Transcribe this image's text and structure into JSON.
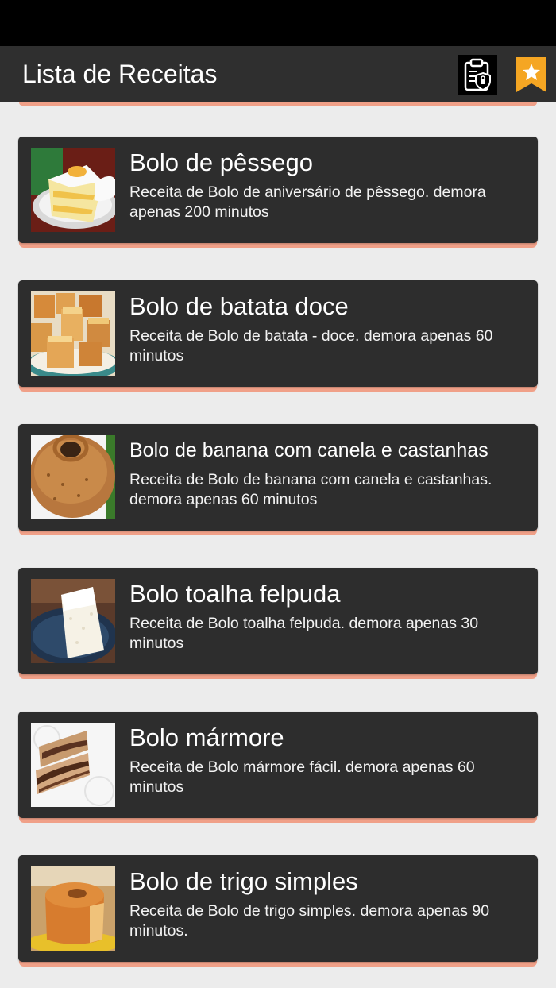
{
  "app_bar": {
    "title": "Lista de Receitas",
    "privacy_icon": "clipboard-lock-icon",
    "favorites_icon": "bookmark-star-icon",
    "accent_color": "#f0a088",
    "favorites_color": "#f5a623"
  },
  "recipes": [
    {
      "title": "Bolo de pêssego",
      "description": "Receita de Bolo de aniversário de pêssego. demora apenas 200 minutos",
      "image": "peach-cake-photo"
    },
    {
      "title": "Bolo de batata doce",
      "description": "Receita de Bolo de batata - doce. demora apenas 60 minutos",
      "image": "sweet-potato-cake-photo"
    },
    {
      "title": "Bolo de banana com canela e castanhas",
      "description": "Receita de Bolo de banana com canela e castanhas. demora apenas 60 minutos",
      "image": "banana-cake-photo"
    },
    {
      "title": "Bolo toalha felpuda",
      "description": "Receita de Bolo toalha felpuda. demora apenas 30 minutos",
      "image": "coconut-cake-photo"
    },
    {
      "title": "Bolo mármore",
      "description": "Receita de Bolo mármore fácil. demora apenas 60 minutos",
      "image": "marble-cake-photo"
    },
    {
      "title": "Bolo de trigo simples",
      "description": "Receita de Bolo de trigo simples. demora apenas 90 minutos.",
      "image": "wheat-cake-photo"
    }
  ]
}
